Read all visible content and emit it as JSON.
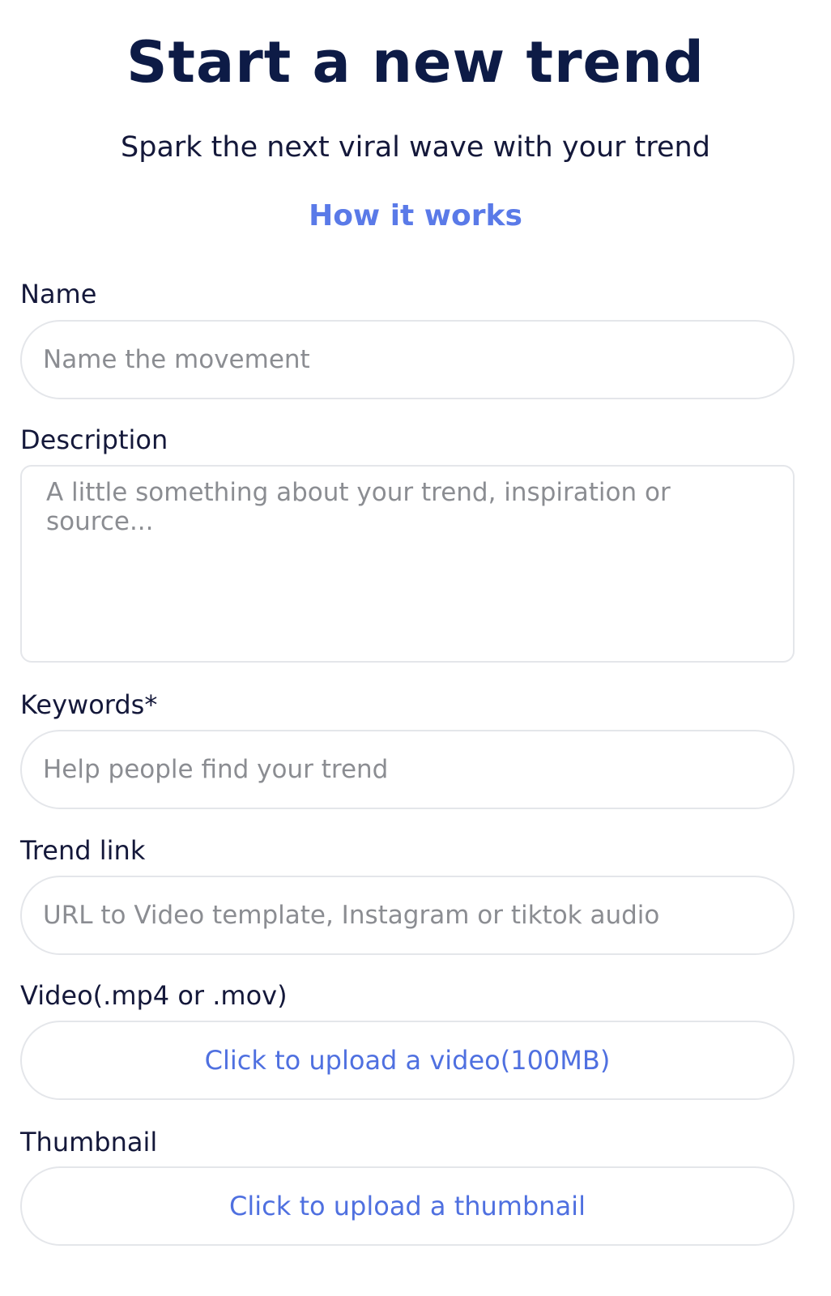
{
  "header": {
    "title": "Start a new trend",
    "subtitle": "Spark the next viral wave with your trend",
    "how_it_works": "How it works"
  },
  "form": {
    "name": {
      "label": "Name",
      "placeholder": "Name the movement",
      "value": ""
    },
    "description": {
      "label": "Description",
      "placeholder": "A little something about your trend, inspiration or source...",
      "value": ""
    },
    "keywords": {
      "label": "Keywords*",
      "placeholder": "Help people find your trend",
      "value": ""
    },
    "trend_link": {
      "label": "Trend link",
      "placeholder": "URL to Video template, Instagram or tiktok audio",
      "value": ""
    },
    "video": {
      "label": "Video(.mp4 or .mov)",
      "button": "Click to upload a video(100MB)"
    },
    "thumbnail": {
      "label": "Thumbnail",
      "button": "Click to upload a thumbnail"
    }
  },
  "colors": {
    "title": "#0d1b46",
    "accent": "#4f70e0",
    "placeholder": "#8b8d92",
    "border": "#e4e6ea"
  }
}
